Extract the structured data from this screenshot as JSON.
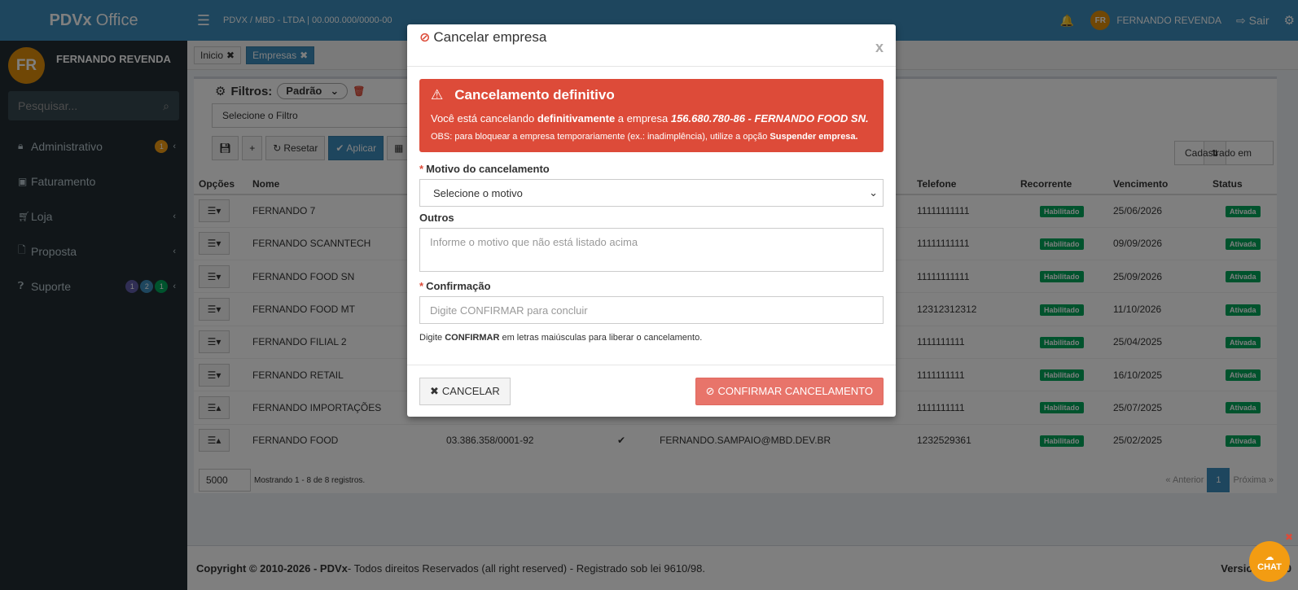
{
  "app": {
    "logo_bold": "PDVx",
    "logo_rest": "Office"
  },
  "header": {
    "company": "PDVX / MBD - LTDA | 00.000.000/0000-00",
    "user_initials": "FR",
    "user_name": "FERNANDO REVENDA",
    "logout": "Sair"
  },
  "sidebar": {
    "user_initials": "FR",
    "user_name": "FERNANDO REVENDA",
    "search_placeholder": "Pesquisar...",
    "items": [
      {
        "label": "Administrativo",
        "icon": "lock-icon"
      },
      {
        "label": "Faturamento",
        "icon": "money-icon"
      },
      {
        "label": "Loja",
        "icon": "cart-icon"
      },
      {
        "label": "Proposta",
        "icon": "file-icon"
      },
      {
        "label": "Suporte",
        "icon": "question-icon"
      }
    ],
    "badges": {
      "admin": "1",
      "sup1": "1",
      "sup2": "2",
      "sup3": "1"
    }
  },
  "tabs": [
    {
      "label": "Inicio"
    },
    {
      "label": "Empresas"
    }
  ],
  "filters": {
    "label": "Filtros:",
    "preset": "Padrão",
    "filter_placeholder": "Selecione o Filtro",
    "reset": "Resetar",
    "apply": "Aplicar",
    "order": "Cadastrado em"
  },
  "table": {
    "headers": {
      "options": "Opções",
      "name": "Nome",
      "phone": "Telefone",
      "recurrent": "Recorrente",
      "due": "Vencimento",
      "status": "Status"
    },
    "rows": [
      {
        "name": "FERNANDO 7",
        "phone": "11111111111",
        "rec": "Habilitado",
        "due": "25/06/2026",
        "status": "Ativada"
      },
      {
        "name": "FERNANDO SCANNTECH",
        "phone": "11111111111",
        "rec": "Habilitado",
        "due": "09/09/2026",
        "status": "Ativada"
      },
      {
        "name": "FERNANDO FOOD SN",
        "phone": "11111111111",
        "rec": "Habilitado",
        "due": "25/09/2026",
        "status": "Ativada"
      },
      {
        "name": "FERNANDO FOOD MT",
        "phone": "12312312312",
        "rec": "Habilitado",
        "due": "11/10/2026",
        "status": "Ativada"
      },
      {
        "name": "FERNANDO FILIAL 2",
        "phone": "1111111111",
        "rec": "Habilitado",
        "due": "25/04/2025",
        "status": "Ativada"
      },
      {
        "name": "FERNANDO RETAIL",
        "phone": "1111111111",
        "rec": "Habilitado",
        "due": "16/10/2025",
        "status": "Ativada"
      },
      {
        "name": "FERNANDO IMPORTAÇÕES",
        "phone": "1111111111",
        "rec": "Habilitado",
        "due": "25/07/2025",
        "status": "Ativada"
      },
      {
        "name": "FERNANDO FOOD",
        "cnpj": "03.386.358/0001-92",
        "email": "FERNANDO.SAMPAIO@MBD.DEV.BR",
        "phone": "1232529361",
        "rec": "Habilitado",
        "due": "25/02/2025",
        "status": "Ativada"
      }
    ],
    "page_size": "5000",
    "showing": "Mostrando 1 - 8 de 8 registros.",
    "prev": "« Anterior",
    "page": "1",
    "next": "Próxima »"
  },
  "footer": {
    "copyright": "Copyright © 2010-2026 - PDVx",
    "rights": " - Todos direitos Reservados (all right reserved) - Registrado sob lei 9610/98.",
    "version": "Version 5.0.00"
  },
  "modal": {
    "title": "Cancelar empresa",
    "close": "x",
    "alert_title": "Cancelamento definitivo",
    "alert_pre": "Você está cancelando ",
    "alert_strong": "definitivamente",
    "alert_mid": " a empresa ",
    "alert_company": "156.680.780-86 - FERNANDO FOOD SN.",
    "obs_pre": "OBS: para bloquear a empresa temporariamente (ex.: inadimplência), utilize a opção ",
    "obs_strong": "Suspender empresa.",
    "reason_label": "Motivo do cancelamento",
    "reason_value": "Selecione o motivo",
    "others_label": "Outros",
    "others_placeholder": "Informe o motivo que não está listado acima",
    "confirm_label": "Confirmação",
    "confirm_placeholder": "Digite CONFIRMAR para concluir",
    "help_pre": "Digite ",
    "help_strong": "CONFIRMAR",
    "help_post": " em letras maiúsculas para liberar o cancelamento.",
    "cancel_btn": "CANCELAR",
    "confirm_btn": "CONFIRMAR CANCELAMENTO"
  },
  "chat": {
    "label": "CHAT",
    "close": "✖"
  }
}
